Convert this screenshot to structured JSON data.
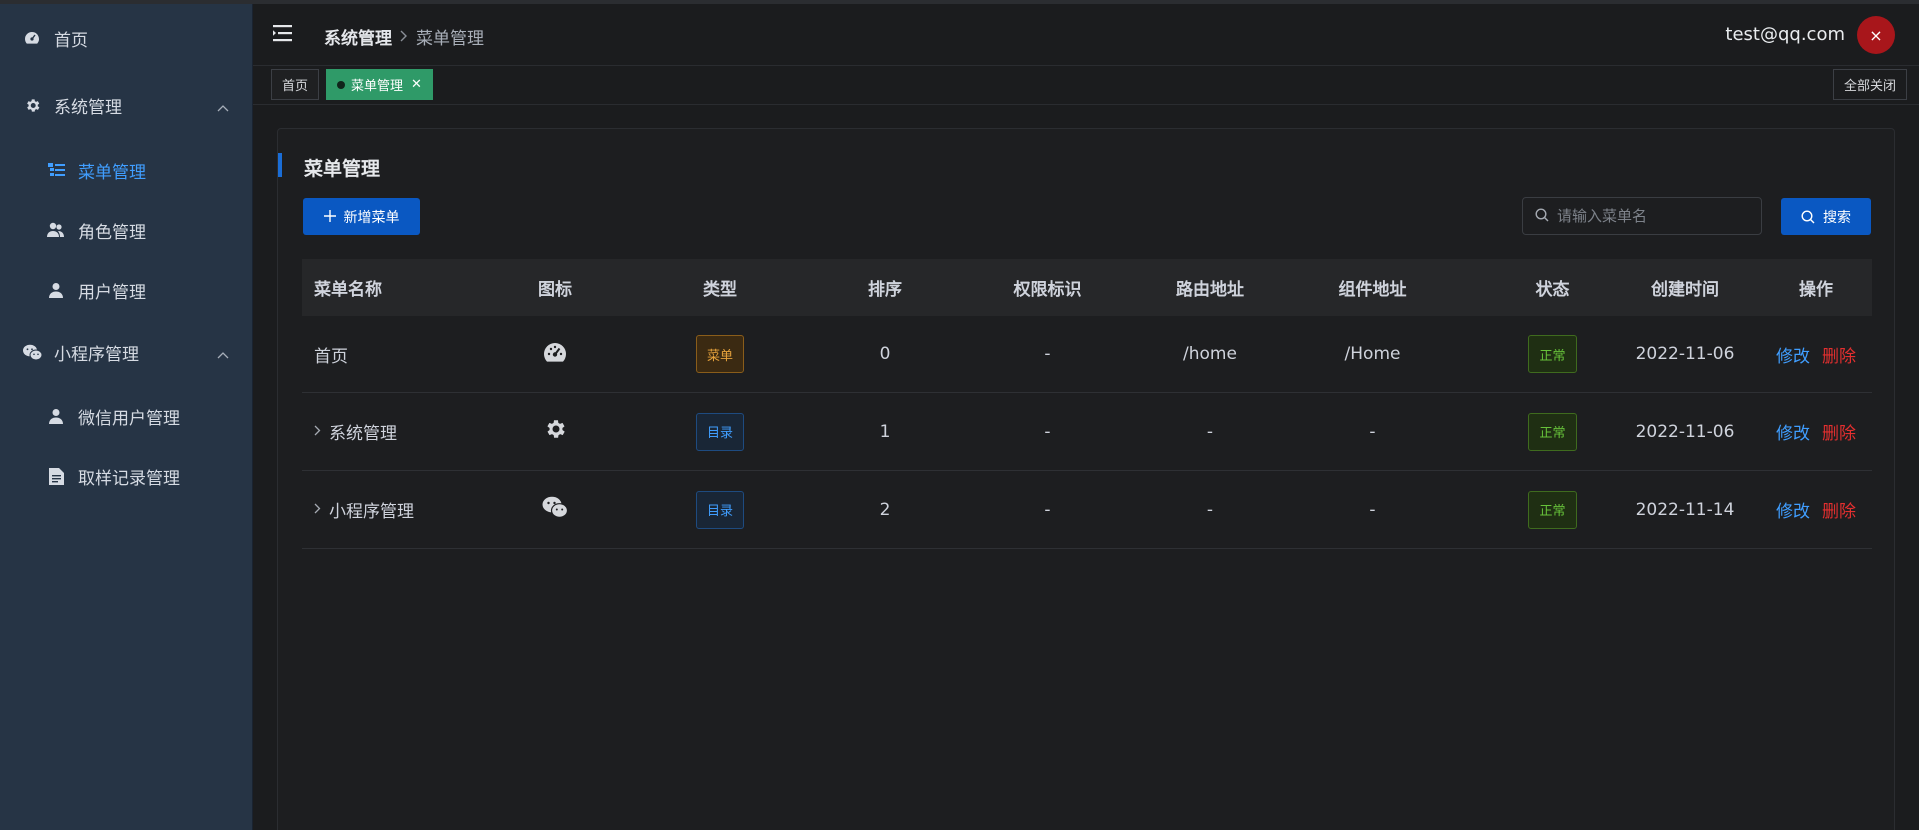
{
  "sidebar": {
    "items": [
      {
        "label": "首页",
        "icon": "dashboard-icon"
      },
      {
        "label": "系统管理",
        "icon": "gear-icon"
      },
      {
        "label": "菜单管理",
        "icon": "tree-list-icon"
      },
      {
        "label": "角色管理",
        "icon": "users-icon"
      },
      {
        "label": "用户管理",
        "icon": "user-icon"
      },
      {
        "label": "小程序管理",
        "icon": "wechat-icon"
      },
      {
        "label": "微信用户管理",
        "icon": "user-icon"
      },
      {
        "label": "取样记录管理",
        "icon": "document-icon"
      }
    ]
  },
  "header": {
    "breadcrumb": [
      "系统管理",
      "菜单管理"
    ],
    "user_email": "test@qq.com",
    "avatar_glyph": "×"
  },
  "tags": {
    "items": [
      {
        "label": "首页"
      },
      {
        "label": "菜单管理"
      }
    ],
    "close_all": "全部关闭"
  },
  "page": {
    "title": "菜单管理",
    "add_button": "新增菜单",
    "search_placeholder": "请输入菜单名",
    "search_button": "搜索"
  },
  "table": {
    "columns": [
      "菜单名称",
      "图标",
      "类型",
      "排序",
      "权限标识",
      "路由地址",
      "组件地址",
      "状态",
      "创建时间",
      "操作"
    ],
    "rows": [
      {
        "name": "首页",
        "icon": "dashboard-icon",
        "type": "菜单",
        "sort": "0",
        "perm": "-",
        "route": "/home",
        "component": "/Home",
        "status": "正常",
        "created": "2022-11-06",
        "edit": "修改",
        "delete": "删除",
        "expandable": false
      },
      {
        "name": "系统管理",
        "icon": "gear-icon",
        "type": "目录",
        "sort": "1",
        "perm": "-",
        "route": "-",
        "component": "-",
        "status": "正常",
        "created": "2022-11-06",
        "edit": "修改",
        "delete": "删除",
        "expandable": true
      },
      {
        "name": "小程序管理",
        "icon": "wechat-icon",
        "type": "目录",
        "sort": "2",
        "perm": "-",
        "route": "-",
        "component": "-",
        "status": "正常",
        "created": "2022-11-14",
        "edit": "修改",
        "delete": "删除",
        "expandable": true
      }
    ]
  },
  "colors": {
    "accent": "#409eff",
    "primary_button": "#0a58c2",
    "active_tag": "#2f9a68",
    "danger": "#e32f2f",
    "sidebar_bg": "#263445"
  }
}
